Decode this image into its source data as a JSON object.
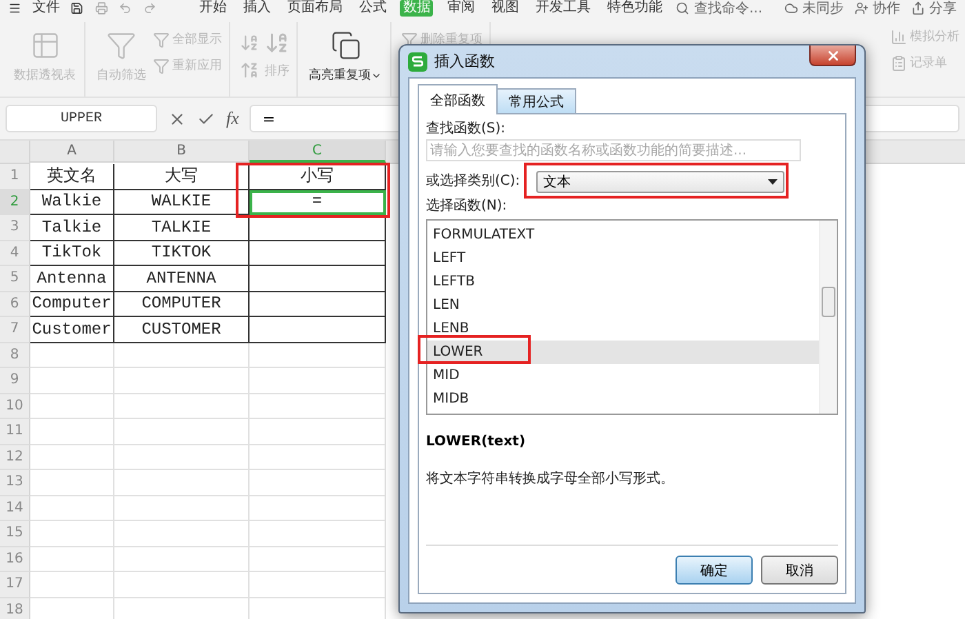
{
  "menu": {
    "file": "文件",
    "tabs": [
      {
        "label": "开始",
        "selected": false
      },
      {
        "label": "插入",
        "selected": false
      },
      {
        "label": "页面布局",
        "selected": false
      },
      {
        "label": "公式",
        "selected": false
      },
      {
        "label": "数据",
        "selected": true
      },
      {
        "label": "审阅",
        "selected": false
      },
      {
        "label": "视图",
        "selected": false
      },
      {
        "label": "开发工具",
        "selected": false
      },
      {
        "label": "特色功能",
        "selected": false
      }
    ],
    "search": {
      "placeholder": "查找命令..."
    },
    "sync": "未同步",
    "collab": "协作",
    "share": "分享"
  },
  "ribbon": {
    "groups": [
      {
        "items": [
          {
            "kind": "large",
            "label": "数据透视表",
            "disabled": true
          }
        ]
      },
      {
        "items": [
          {
            "kind": "large",
            "label": "自动筛选",
            "disabled": true
          },
          {
            "kind": "small",
            "label": "全部显示",
            "disabled": true
          },
          {
            "kind": "small",
            "label": "重新应用",
            "disabled": true
          }
        ]
      },
      {
        "items": [
          {
            "kind": "sort",
            "label": "排序",
            "disabled": true
          }
        ]
      },
      {
        "items": [
          {
            "kind": "split",
            "label": "高亮重复项",
            "disabled": false
          }
        ]
      },
      {
        "items": [
          {
            "kind": "small",
            "label": "删除重复项",
            "disabled": true
          }
        ]
      }
    ],
    "right_items": [
      {
        "label": "模拟分析",
        "disabled": true
      },
      {
        "label": "记录单",
        "disabled": true
      }
    ]
  },
  "formula_bar": {
    "name_box": "UPPER",
    "fx": "fx",
    "formula": "="
  },
  "sheet": {
    "columns": [
      {
        "label": "A",
        "selected": false
      },
      {
        "label": "B",
        "selected": false
      },
      {
        "label": "C",
        "selected": true
      }
    ],
    "rows": [
      {
        "number": "1",
        "selected": false,
        "cells": [
          {
            "text": "英文名",
            "active": false
          },
          {
            "text": "大写",
            "active": false
          },
          {
            "text": "小写",
            "active": false
          }
        ]
      },
      {
        "number": "2",
        "selected": true,
        "cells": [
          {
            "text": "Walkie",
            "active": false
          },
          {
            "text": "WALKIE",
            "active": false
          },
          {
            "text": "=",
            "active": true,
            "annotated": true
          }
        ]
      },
      {
        "number": "3",
        "selected": false,
        "cells": [
          {
            "text": "Talkie",
            "active": false
          },
          {
            "text": "TALKIE",
            "active": false
          },
          {
            "active": false
          }
        ]
      },
      {
        "number": "4",
        "selected": false,
        "cells": [
          {
            "text": "TikTok",
            "active": false
          },
          {
            "text": "TIKTOK",
            "active": false
          },
          {
            "active": false
          }
        ]
      },
      {
        "number": "5",
        "selected": false,
        "cells": [
          {
            "text": "Antenna",
            "active": false
          },
          {
            "text": "ANTENNA",
            "active": false
          },
          {
            "active": false
          }
        ]
      },
      {
        "number": "6",
        "selected": false,
        "cells": [
          {
            "text": "Computer",
            "active": false
          },
          {
            "text": "COMPUTER",
            "active": false
          },
          {
            "active": false
          }
        ]
      },
      {
        "number": "7",
        "selected": false,
        "cells": [
          {
            "text": "Customer",
            "active": false
          },
          {
            "text": "CUSTOMER",
            "active": false
          },
          {
            "active": false
          }
        ]
      },
      {
        "number": "8",
        "selected": false
      },
      {
        "number": "9",
        "selected": false
      },
      {
        "number": "10",
        "selected": false
      },
      {
        "number": "11",
        "selected": false
      },
      {
        "number": "12",
        "selected": false
      },
      {
        "number": "13",
        "selected": false
      },
      {
        "number": "14",
        "selected": false
      },
      {
        "number": "15",
        "selected": false
      },
      {
        "number": "16",
        "selected": false
      },
      {
        "number": "17",
        "selected": false
      },
      {
        "number": "18",
        "selected": false
      }
    ]
  },
  "dialog": {
    "title": "插入函数",
    "tabs": [
      {
        "label": "全部函数",
        "selected": true
      },
      {
        "label": "常用公式",
        "selected": false
      }
    ],
    "search_label": "查找函数(S):",
    "search": {
      "placeholder": "请输入您要查找的函数名称或函数功能的简要描述..."
    },
    "category_label": "或选择类别(C):",
    "category": {
      "value": "文本",
      "annotated": true
    },
    "function_label": "选择函数(N):",
    "functions": [
      {
        "name": "FORMULATEXT",
        "selected": false,
        "annotated": false
      },
      {
        "name": "LEFT",
        "selected": false,
        "annotated": false
      },
      {
        "name": "LEFTB",
        "selected": false,
        "annotated": false
      },
      {
        "name": "LEN",
        "selected": false,
        "annotated": false
      },
      {
        "name": "LENB",
        "selected": false,
        "annotated": false
      },
      {
        "name": "LOWER",
        "selected": true,
        "annotated": true
      },
      {
        "name": "MID",
        "selected": false,
        "annotated": false
      },
      {
        "name": "MIDB",
        "selected": false,
        "annotated": false
      }
    ],
    "signature": "LOWER(text)",
    "description": "将文本字符串转换成字母全部小写形式。",
    "buttons": [
      {
        "label": "确定",
        "kind": "primary"
      },
      {
        "label": "取消",
        "kind": "secondary"
      }
    ]
  }
}
